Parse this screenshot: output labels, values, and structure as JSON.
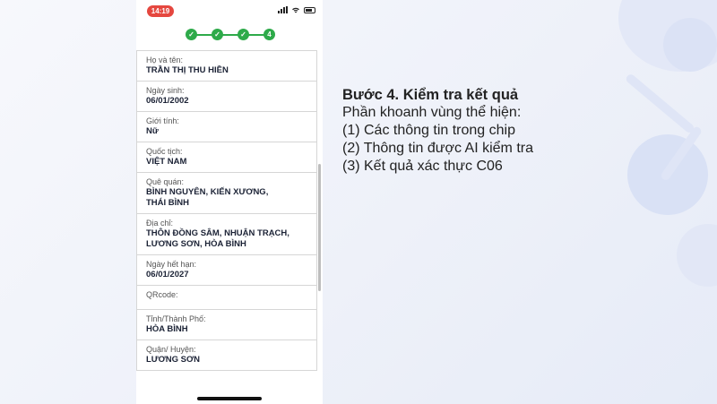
{
  "status_bar": {
    "time": "14:19"
  },
  "stepper": {
    "steps": [
      "✓",
      "✓",
      "✓",
      "4"
    ],
    "active_step": 4,
    "accent": "#2eaa4a"
  },
  "fields": [
    {
      "label": "Họ và tên:",
      "value": "TRẦN THỊ THU HIỀN"
    },
    {
      "label": "Ngày sinh:",
      "value": "06/01/2002"
    },
    {
      "label": "Giới tính:",
      "value": "Nữ"
    },
    {
      "label": "Quốc tịch:",
      "value": "VIỆT NAM"
    },
    {
      "label": "Quê quán:",
      "value": "BÌNH NGUYÊN, KIẾN XƯƠNG,\nTHÁI BÌNH"
    },
    {
      "label": "Địa chỉ:",
      "value": "THÔN ĐỒNG SÂM, NHUẬN TRẠCH,\nLƯƠNG SƠN, HÒA BÌNH"
    },
    {
      "label": "Ngày hết hạn:",
      "value": "06/01/2027"
    },
    {
      "label": "QRcode:",
      "value": ""
    },
    {
      "label": "Tỉnh/Thành Phố:",
      "value": "HÒA BÌNH"
    },
    {
      "label": "Quận/ Huyện:",
      "value": "LƯƠNG SƠN"
    }
  ],
  "instructions": {
    "title": "Bước 4. Kiểm tra kết quả",
    "lines": [
      "Phần khoanh vùng thể hiện:",
      "(1) Các thông tin trong chip",
      "(2) Thông tin được AI kiểm tra",
      "(3) Kết quả xác thực C06"
    ]
  },
  "colors": {
    "status_pill": "#e5473f",
    "text_dark": "#1b2235"
  }
}
